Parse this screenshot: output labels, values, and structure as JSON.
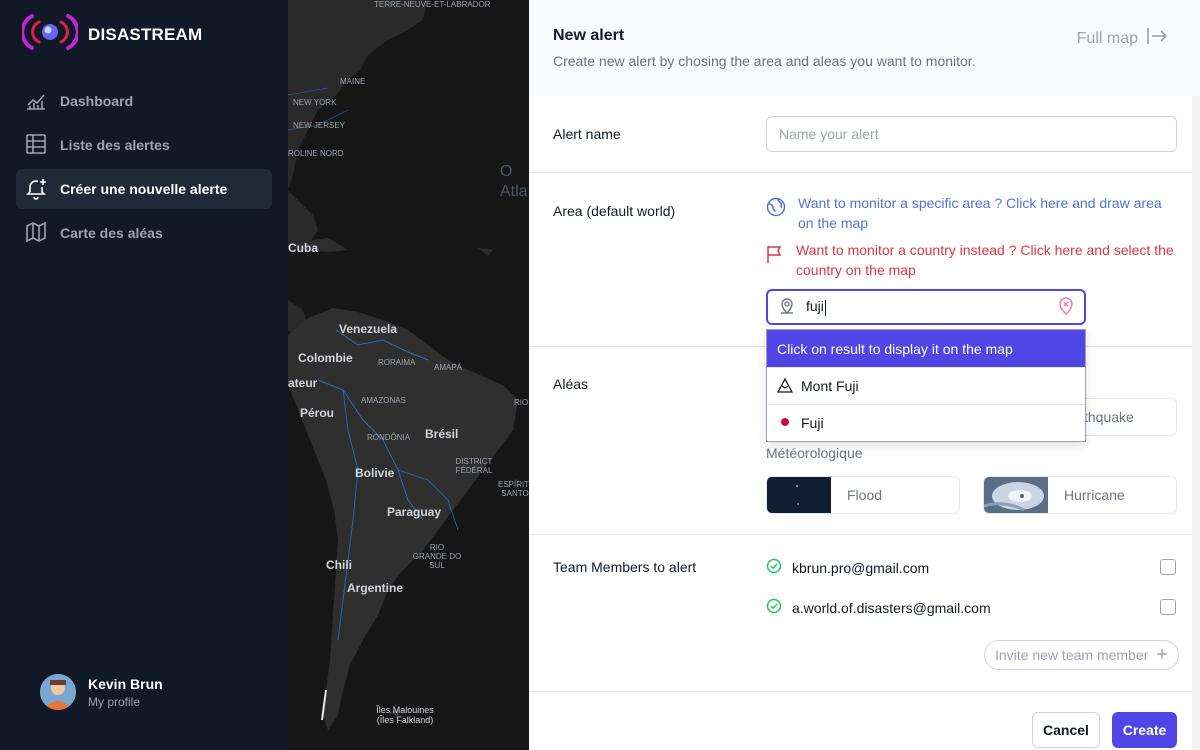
{
  "app": {
    "name": "DISASTREAM"
  },
  "sidebar": {
    "items": [
      {
        "label": "Dashboard",
        "icon": "chart-line-icon",
        "active": false
      },
      {
        "label": "Liste des alertes",
        "icon": "table-icon",
        "active": false
      },
      {
        "label": "Créer une nouvelle alerte",
        "icon": "bell-plus-icon",
        "active": true
      },
      {
        "label": "Carte des aléas",
        "icon": "map-icon",
        "active": false
      }
    ],
    "profile": {
      "name": "Kevin Brun",
      "subtitle": "My profile"
    }
  },
  "map": {
    "labels": {
      "terre_neuve": "TERRE-NEUVE-ET-LABRADOR",
      "maine": "MAINE",
      "new_york": "NEW YORK",
      "new_jersey": "NEW JERSEY",
      "caroline": "ROLINE NORD",
      "ocean": "O Atla",
      "cuba": "Cuba",
      "venezuela": "Venezuela",
      "colombie": "Colombie",
      "roraima": "RORAIMA",
      "amapa": "AMAPÁ",
      "equateur": "ateur",
      "perou": "Pérou",
      "amazonas": "AMAZONAS",
      "rondonia": "RONDÔNIA",
      "bresil": "Brésil",
      "rio": "RIO DE",
      "district": "DISTRICT FÉDÉRAL",
      "espirito": "ESPÍRITO SANTO",
      "bolivie": "Bolivie",
      "paraguay": "Paraguay",
      "rio_grande": "RIO GRANDE DO SUL",
      "chili": "Chili",
      "argentine": "Argentine",
      "malouines": "Îles Malouines (Îles Falkland)"
    }
  },
  "panel": {
    "title": "New alert",
    "description": "Create new alert by chosing the area and aleas you want to monitor.",
    "full_map": "Full map",
    "alert_name": {
      "label": "Alert name",
      "placeholder": "Name your alert"
    },
    "area": {
      "label": "Area (default world)",
      "draw_link": "Want to monitor a specific area ? Click here and draw area on the map",
      "country_link": "Want to monitor a country instead ? Click here and select the country on the map",
      "search_value": "fuji",
      "dropdown_header": "Click on result to display it on the map",
      "results": [
        {
          "label": "Mont Fuji",
          "icon": "mountain-icon"
        },
        {
          "label": "Fuji",
          "icon": "japan-flag-icon"
        }
      ]
    },
    "aleas": {
      "label": "Aléas",
      "hidden_option": "thquake",
      "meteo_heading": "Météorologique",
      "options": [
        {
          "label": "Flood"
        },
        {
          "label": "Hurricane"
        }
      ]
    },
    "team": {
      "label": "Team Members to alert",
      "members": [
        {
          "email": "kbrun.pro@gmail.com"
        },
        {
          "email": "a.world.of.disasters@gmail.com"
        }
      ],
      "invite_label": "Invite new team member"
    },
    "actions": {
      "cancel": "Cancel",
      "create": "Create"
    }
  },
  "colors": {
    "accent": "#4f46e5",
    "sidebar_bg": "#111827",
    "link_blue": "#4f73d9",
    "link_red": "#dc3545",
    "success": "#22c55e"
  }
}
